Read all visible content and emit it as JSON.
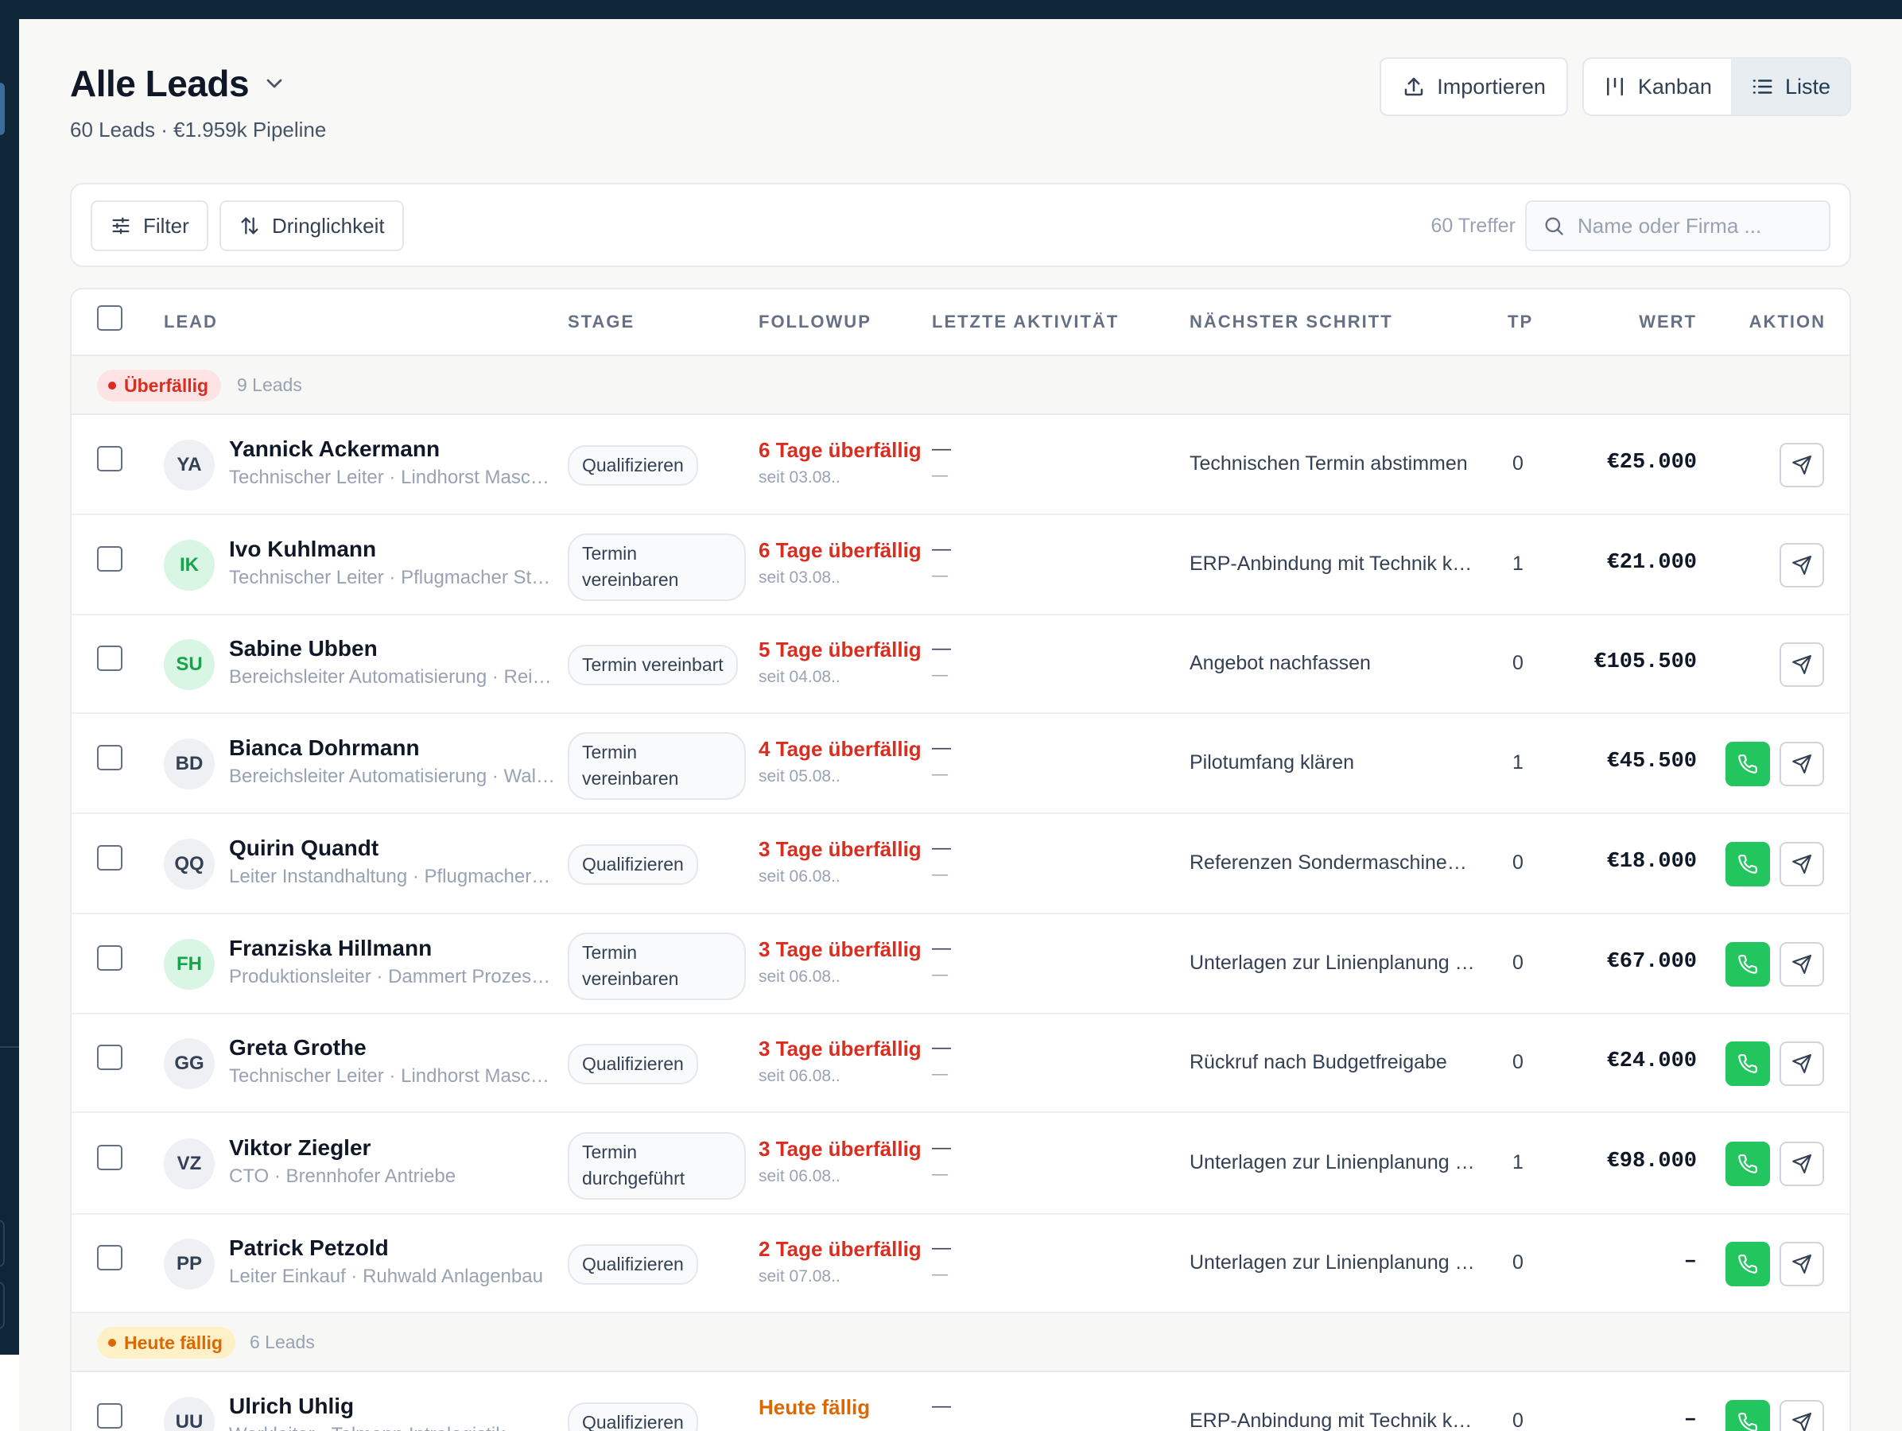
{
  "header": {
    "title": "Alle Leads",
    "subtitle": "60 Leads · €1.959k Pipeline",
    "import_label": "Importieren",
    "view_kanban": "Kanban",
    "view_list": "Liste"
  },
  "toolbar": {
    "filter_label": "Filter",
    "sort_label": "Dringlichkeit",
    "hits": "60 Treffer",
    "search_placeholder": "Name oder Firma ...",
    "search_value": ""
  },
  "table": {
    "columns": {
      "lead": "LEAD",
      "stage": "STAGE",
      "followup": "FOLLOWUP",
      "last_activity": "LETZTE AKTIVITÄT",
      "next_step": "NÄCHSTER SCHRITT",
      "tp": "TP",
      "value": "WERT",
      "action": "AKTION"
    },
    "groups": [
      {
        "label": "Überfällig",
        "count": "9 Leads",
        "color": "#d92d20",
        "bg": "#fde3e3"
      },
      {
        "label": "Heute fällig",
        "count": "6 Leads",
        "color": "#dc6803",
        "bg": "#fef0c7"
      }
    ],
    "rows": [
      {
        "initials": "YA",
        "avatar_tone": "gray",
        "name": "Yannick Ackermann",
        "sub": "Technischer Leiter · Lindhorst Maschinenbau",
        "stage": "Qualifizieren",
        "followup": "6 Tage überfällig",
        "since": "seit 03.08..",
        "activity": "—",
        "activity_sub": "—",
        "next": "Technischen Termin abstimmen",
        "tp": "0",
        "value": "€25.000",
        "call": false
      },
      {
        "initials": "IK",
        "avatar_tone": "green",
        "name": "Ivo Kuhlmann",
        "sub": "Technischer Leiter · Pflugmacher Stahlbau",
        "stage": "Termin vereinbaren",
        "followup": "6 Tage überfällig",
        "since": "seit 03.08..",
        "activity": "—",
        "activity_sub": "—",
        "next": "ERP-Anbindung mit Technik klären",
        "tp": "1",
        "value": "€21.000",
        "call": false
      },
      {
        "initials": "SU",
        "avatar_tone": "green",
        "name": "Sabine Ubben",
        "sub": "Bereichsleiter Automatisierung · Reimers Technik",
        "stage": "Termin vereinbart",
        "followup": "5 Tage überfällig",
        "since": "seit 04.08..",
        "activity": "—",
        "activity_sub": "—",
        "next": "Angebot nachfassen",
        "tp": "0",
        "value": "€105.500",
        "call": false
      },
      {
        "initials": "BD",
        "avatar_tone": "gray",
        "name": "Bianca Dohrmann",
        "sub": "Bereichsleiter Automatisierung · Walter Systeme",
        "stage": "Termin vereinbaren",
        "followup": "4 Tage überfällig",
        "since": "seit 05.08..",
        "activity": "—",
        "activity_sub": "—",
        "next": "Pilotumfang klären",
        "tp": "1",
        "value": "€45.500",
        "call": true
      },
      {
        "initials": "QQ",
        "avatar_tone": "gray",
        "name": "Quirin Quandt",
        "sub": "Leiter Instandhaltung · Pflugmacher Stahlbau",
        "stage": "Qualifizieren",
        "followup": "3 Tage überfällig",
        "since": "seit 06.08..",
        "activity": "—",
        "activity_sub": "—",
        "next": "Referenzen Sondermaschinenbau senden",
        "tp": "0",
        "value": "€18.000",
        "call": true
      },
      {
        "initials": "FH",
        "avatar_tone": "green",
        "name": "Franziska Hillmann",
        "sub": "Produktionsleiter · Dammert Prozesstechnik",
        "stage": "Termin vereinbaren",
        "followup": "3 Tage überfällig",
        "since": "seit 06.08..",
        "activity": "—",
        "activity_sub": "—",
        "next": "Unterlagen zur Linienplanung senden",
        "tp": "0",
        "value": "€67.000",
        "call": true
      },
      {
        "initials": "GG",
        "avatar_tone": "gray",
        "name": "Greta Grothe",
        "sub": "Technischer Leiter · Lindhorst Maschinenbau",
        "stage": "Qualifizieren",
        "followup": "3 Tage überfällig",
        "since": "seit 06.08..",
        "activity": "—",
        "activity_sub": "—",
        "next": "Rückruf nach Budgetfreigabe",
        "tp": "0",
        "value": "€24.000",
        "call": true
      },
      {
        "initials": "VZ",
        "avatar_tone": "gray",
        "name": "Viktor Ziegler",
        "sub": "CTO · Brennhofer Antriebe",
        "stage": "Termin durchgeführt",
        "followup": "3 Tage überfällig",
        "since": "seit 06.08..",
        "activity": "—",
        "activity_sub": "—",
        "next": "Unterlagen zur Linienplanung senden",
        "tp": "1",
        "value": "€98.000",
        "call": true
      },
      {
        "initials": "PP",
        "avatar_tone": "gray",
        "name": "Patrick Petzold",
        "sub": "Leiter Einkauf · Ruhwald Anlagenbau",
        "stage": "Qualifizieren",
        "followup": "2 Tage überfällig",
        "since": "seit 07.08..",
        "activity": "—",
        "activity_sub": "—",
        "next": "Unterlagen zur Linienplanung senden",
        "tp": "0",
        "value": "–",
        "call": true
      },
      {
        "initials": "UU",
        "avatar_tone": "gray",
        "name": "Ulrich Uhlig",
        "sub": "Werkleiter · Tolmann Intralogistik",
        "stage": "Qualifizieren",
        "followup": "Heute fällig",
        "since": "",
        "activity": "—",
        "activity_sub": "",
        "next": "ERP-Anbindung mit Technik klären",
        "tp": "0",
        "value": "–",
        "call": true
      }
    ]
  },
  "colors": {
    "sidebar": "#0f2538",
    "overdue": "#d92d20",
    "due_today": "#dc6803",
    "call_button": "#22c55e",
    "avatar_gray_bg": "#eef0f3",
    "avatar_gray_fg": "#344054",
    "avatar_green_bg": "#d9f5e4",
    "avatar_green_fg": "#16a34a"
  },
  "icons": {
    "title_dropdown": "chevron-down-icon",
    "import": "upload-icon",
    "kanban": "kanban-icon",
    "list": "list-icon",
    "filter": "sliders-icon",
    "sort": "sort-arrows-icon",
    "search": "search-icon",
    "call": "phone-icon",
    "send": "send-icon"
  }
}
